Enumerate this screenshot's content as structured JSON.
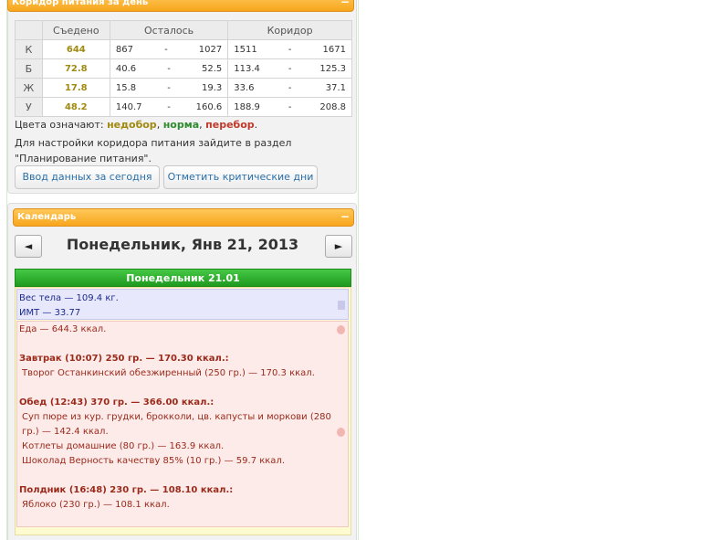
{
  "corridor": {
    "title": "Коридор питания за день",
    "headers": {
      "eaten": "Съедено",
      "left": "Осталось",
      "corridor": "Коридор"
    },
    "rows": [
      {
        "label": "К",
        "eaten": "644",
        "left_min": "867",
        "left_max": "1027",
        "cor_min": "1511",
        "cor_max": "1671"
      },
      {
        "label": "Б",
        "eaten": "72.8",
        "left_min": "40.6",
        "left_max": "52.5",
        "cor_min": "113.4",
        "cor_max": "125.3"
      },
      {
        "label": "Ж",
        "eaten": "17.8",
        "left_min": "15.8",
        "left_max": "19.3",
        "cor_min": "33.6",
        "cor_max": "37.1"
      },
      {
        "label": "У",
        "eaten": "48.2",
        "left_min": "140.7",
        "left_max": "160.6",
        "cor_min": "188.9",
        "cor_max": "208.8"
      }
    ],
    "dash": "-",
    "colors_prefix": "Цвета означают:",
    "under": "недобор",
    "comma": ",",
    "norm": "норма",
    "over": "перебор",
    "period": ".",
    "hint": "Для настройки коридора питания зайдите в раздел \"Планирование питания\".",
    "btn_input": "Ввод данных за сегодня",
    "btn_critical": "Отметить критические дни"
  },
  "calendar": {
    "title": "Календарь",
    "prev": "◄",
    "next": "►",
    "date_title": "Понедельник, Янв 21, 2013",
    "day_bar": "Понедельник 21.01",
    "weight": "Вес тела — 109.4 кг.",
    "bmi": "ИМТ — 33.77",
    "food": {
      "total": "Еда — 644.3 ккал.",
      "breakfast": "Завтрак (10:07) 250 гр. — 170.30 ккал.:",
      "breakfast_items": [
        "Творог Останкинский обезжиренный (250 гр.) — 170.3 ккал."
      ],
      "lunch": "Обед (12:43) 370 гр. — 366.00 ккал.:",
      "lunch_items": [
        "Суп пюре из кур. грудки, брокколи, цв. капусты и моркови (280 гр.) — 142.4 ккал.",
        "Котлеты домашние (80 гр.) — 163.9 ккал.",
        "Шоколад Верность качеству 85% (10 гр.) — 59.7 ккал."
      ],
      "snack": "Полдник (16:48) 230 гр. — 108.10 ккал.:",
      "snack_items": [
        "Яблоко (230 гр.) — 108.1 ккал."
      ]
    }
  },
  "colors": {
    "header_orange": "#f7a51c",
    "under": "#a08a10",
    "norm": "#2e8b2e",
    "over": "#c0392b",
    "day_bar_green": "#1f9a1f",
    "weight_text": "#1a2a8a",
    "food_text": "#9a2a1a"
  }
}
